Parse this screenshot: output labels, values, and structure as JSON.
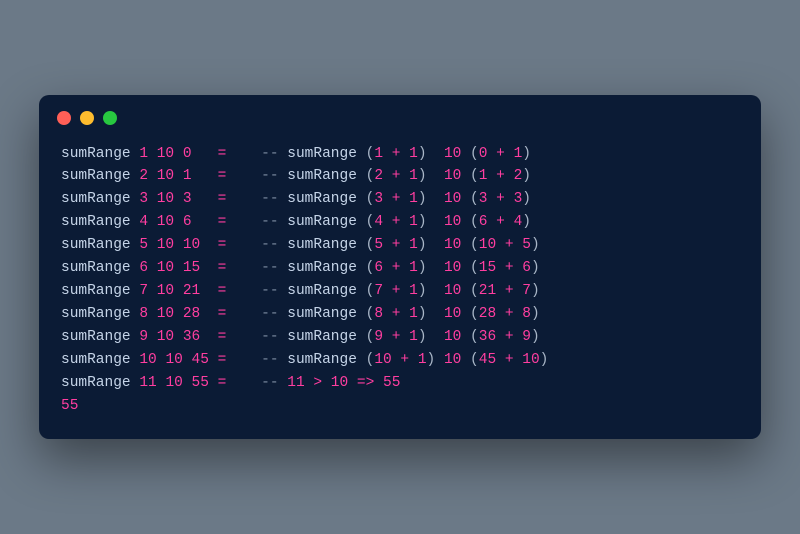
{
  "window": {
    "dot_red": "red",
    "dot_yellow": "yellow",
    "dot_green": "green"
  },
  "code": {
    "fn": "sumRange",
    "eq": "=",
    "dashdash": "--",
    "lp": "(",
    "rp": ")",
    "plus": "+",
    "gt": ">",
    "arrow": "=>",
    "one": "1",
    "ten": "10",
    "rows": [
      {
        "a": "1",
        "b": "10",
        "c": "0",
        "pad1": "  ",
        "cx": "1",
        "cxpad": "  ",
        "cy": "0",
        "cz": "1",
        "czpad": ""
      },
      {
        "a": "2",
        "b": "10",
        "c": "1",
        "pad1": "  ",
        "cx": "2",
        "cxpad": "  ",
        "cy": "1",
        "cz": "2",
        "czpad": ""
      },
      {
        "a": "3",
        "b": "10",
        "c": "3",
        "pad1": "  ",
        "cx": "3",
        "cxpad": "  ",
        "cy": "3",
        "cz": "3",
        "czpad": ""
      },
      {
        "a": "4",
        "b": "10",
        "c": "6",
        "pad1": "  ",
        "cx": "4",
        "cxpad": "  ",
        "cy": "6",
        "cz": "4",
        "czpad": ""
      },
      {
        "a": "5",
        "b": "10",
        "c": "10",
        "pad1": " ",
        "cx": "5",
        "cxpad": "  ",
        "cy": "10",
        "cz": "5",
        "czpad": ""
      },
      {
        "a": "6",
        "b": "10",
        "c": "15",
        "pad1": " ",
        "cx": "6",
        "cxpad": "  ",
        "cy": "15",
        "cz": "6",
        "czpad": ""
      },
      {
        "a": "7",
        "b": "10",
        "c": "21",
        "pad1": " ",
        "cx": "7",
        "cxpad": "  ",
        "cy": "21",
        "cz": "7",
        "czpad": ""
      },
      {
        "a": "8",
        "b": "10",
        "c": "28",
        "pad1": " ",
        "cx": "8",
        "cxpad": "  ",
        "cy": "28",
        "cz": "8",
        "czpad": ""
      },
      {
        "a": "9",
        "b": "10",
        "c": "36",
        "pad1": " ",
        "cx": "9",
        "cxpad": "  ",
        "cy": "36",
        "cz": "9",
        "czpad": ""
      },
      {
        "a": "10",
        "b": "10",
        "c": "45",
        "pad1": "",
        "cx": "10",
        "cxpad": " ",
        "cy": "45",
        "cz": "10",
        "czpad": ""
      }
    ],
    "lastRow": {
      "a": "11",
      "b": "10",
      "c": "55",
      "pad1": "",
      "cmt_a": "11",
      "cmt_b": "10",
      "cmt_r": "55"
    },
    "result": "55"
  }
}
